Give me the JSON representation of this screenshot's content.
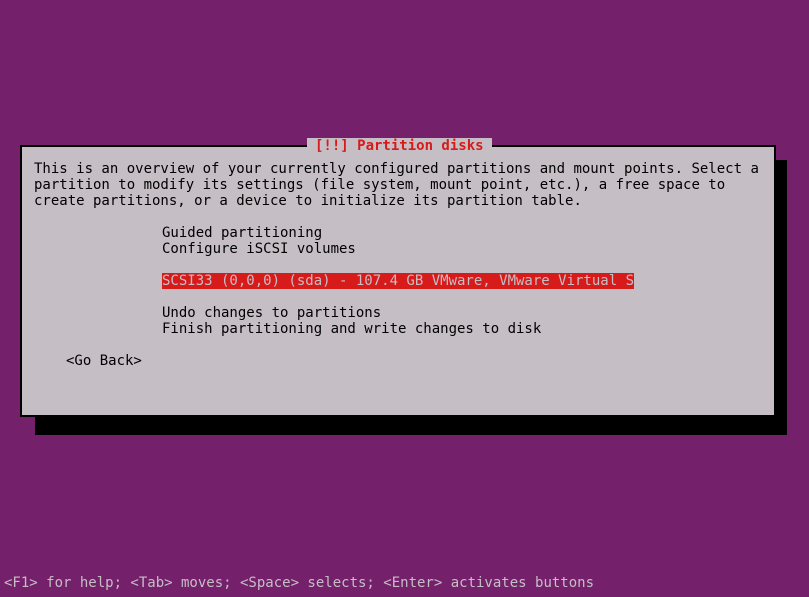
{
  "dialog": {
    "title": "[!!] Partition disks",
    "intro": "This is an overview of your currently configured partitions and mount points. Select a partition to modify its settings (file system, mount point, etc.), a free space to create partitions, or a device to initialize its partition table.",
    "menu": {
      "guided": "Guided partitioning",
      "iscsi": "Configure iSCSI volumes",
      "disk": "SCSI33 (0,0,0) (sda) - 107.4 GB VMware, VMware Virtual S",
      "undo": "Undo changes to partitions",
      "finish": "Finish partitioning and write changes to disk"
    },
    "go_back": "<Go Back>"
  },
  "footer": "<F1> for help; <Tab> moves; <Space> selects; <Enter> activates buttons"
}
